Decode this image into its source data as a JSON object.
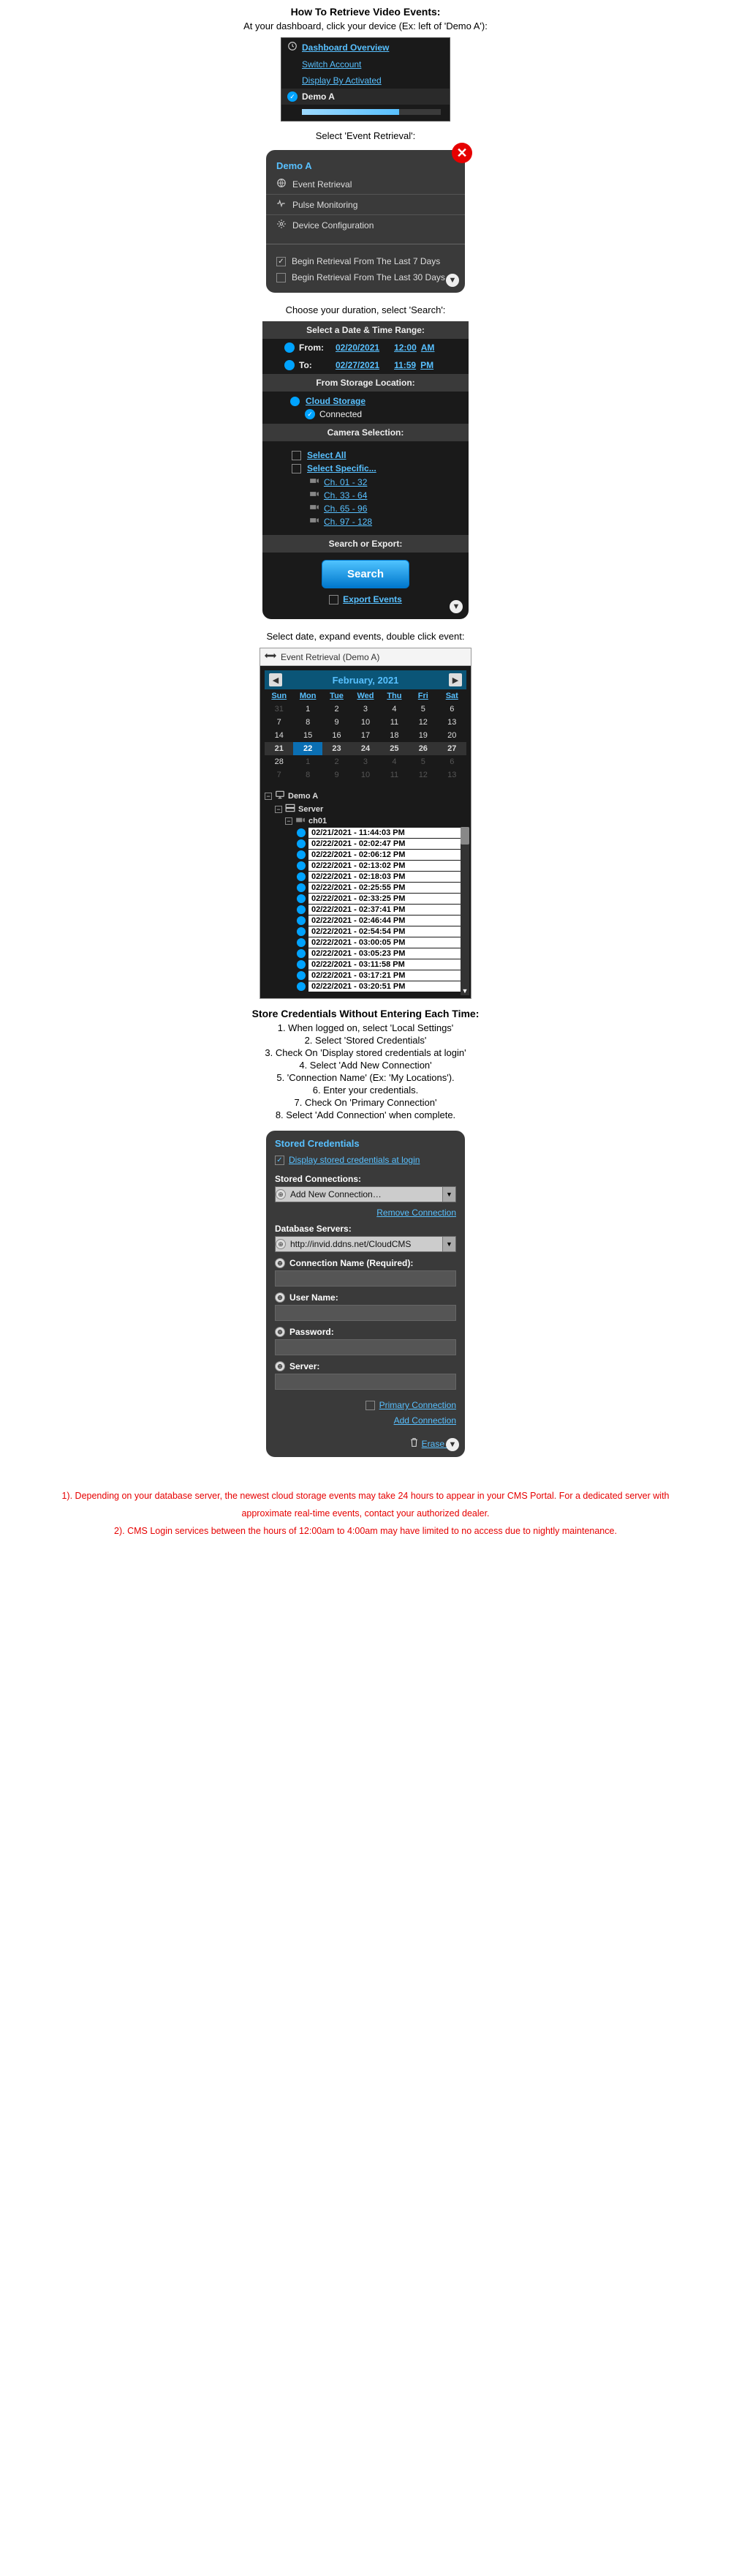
{
  "section1": {
    "title": "How To Retrieve Video Events:",
    "sub": "At your dashboard, click your device (Ex: left of 'Demo A'):"
  },
  "panel1": {
    "overview": "Dashboard Overview",
    "switch": "Switch Account",
    "display": "Display By Activated",
    "device": "Demo A"
  },
  "caption2": "Select 'Event Retrieval':",
  "panel2": {
    "header": "Demo A",
    "items": [
      {
        "label": "Event Retrieval"
      },
      {
        "label": "Pulse Monitoring"
      },
      {
        "label": "Device Configuration"
      }
    ],
    "opt7": "Begin Retrieval From The Last 7 Days",
    "opt30": "Begin Retrieval From The Last 30 Days"
  },
  "caption3": "Choose your duration, select 'Search':",
  "panel3": {
    "sec_date": "Select a Date & Time Range:",
    "from_label": "From:",
    "from_date": "02/20/2021",
    "from_time": "12:00",
    "from_ampm": "AM",
    "to_label": "To:",
    "to_date": "02/27/2021",
    "to_time": "11:59",
    "to_ampm": "PM",
    "sec_storage": "From Storage Location:",
    "cloud": "Cloud Storage",
    "connected": "Connected",
    "sec_cam": "Camera Selection:",
    "select_all": "Select All",
    "select_spec": "Select Specific...",
    "channels": [
      "Ch. 01 - 32",
      "Ch. 33 - 64",
      "Ch. 65 - 96",
      "Ch. 97 - 128"
    ],
    "sec_search": "Search or Export:",
    "search_btn": "Search",
    "export": "Export Events"
  },
  "caption4": "Select date, expand events, double click event:",
  "panel4": {
    "toolbar": "Event Retrieval (Demo A)",
    "month": "February, 2021",
    "dow": [
      "Sun",
      "Mon",
      "Tue",
      "Wed",
      "Thu",
      "Fri",
      "Sat"
    ],
    "grid": [
      [
        {
          "n": "31",
          "dim": true
        },
        {
          "n": "1"
        },
        {
          "n": "2"
        },
        {
          "n": "3"
        },
        {
          "n": "4"
        },
        {
          "n": "5"
        },
        {
          "n": "6"
        }
      ],
      [
        {
          "n": "7"
        },
        {
          "n": "8"
        },
        {
          "n": "9"
        },
        {
          "n": "10"
        },
        {
          "n": "11"
        },
        {
          "n": "12"
        },
        {
          "n": "13"
        }
      ],
      [
        {
          "n": "14"
        },
        {
          "n": "15"
        },
        {
          "n": "16"
        },
        {
          "n": "17"
        },
        {
          "n": "18"
        },
        {
          "n": "19"
        },
        {
          "n": "20"
        }
      ],
      [
        {
          "n": "21",
          "hl": true
        },
        {
          "n": "22",
          "sel": true
        },
        {
          "n": "23",
          "hl": true
        },
        {
          "n": "24",
          "hl": true
        },
        {
          "n": "25",
          "hl": true
        },
        {
          "n": "26",
          "hl": true
        },
        {
          "n": "27",
          "hl": true
        }
      ],
      [
        {
          "n": "28"
        },
        {
          "n": "1",
          "dim": true
        },
        {
          "n": "2",
          "dim": true
        },
        {
          "n": "3",
          "dim": true
        },
        {
          "n": "4",
          "dim": true
        },
        {
          "n": "5",
          "dim": true
        },
        {
          "n": "6",
          "dim": true
        }
      ],
      [
        {
          "n": "7",
          "dim": true
        },
        {
          "n": "8",
          "dim": true
        },
        {
          "n": "9",
          "dim": true
        },
        {
          "n": "10",
          "dim": true
        },
        {
          "n": "11",
          "dim": true
        },
        {
          "n": "12",
          "dim": true
        },
        {
          "n": "13",
          "dim": true
        }
      ]
    ],
    "root": "Demo A",
    "server": "Server",
    "channel": "ch01",
    "events": [
      "02/21/2021 - 11:44:03 PM",
      "02/22/2021 - 02:02:47 PM",
      "02/22/2021 - 02:06:12 PM",
      "02/22/2021 - 02:13:02 PM",
      "02/22/2021 - 02:18:03 PM",
      "02/22/2021 - 02:25:55 PM",
      "02/22/2021 - 02:33:25 PM",
      "02/22/2021 - 02:37:41 PM",
      "02/22/2021 - 02:46:44 PM",
      "02/22/2021 - 02:54:54 PM",
      "02/22/2021 - 03:00:05 PM",
      "02/22/2021 - 03:05:23 PM",
      "02/22/2021 - 03:11:58 PM",
      "02/22/2021 - 03:17:21 PM",
      "02/22/2021 - 03:20:51 PM"
    ]
  },
  "section5": {
    "title": "Store Credentials Without Entering Each Time:",
    "steps": [
      "1. When logged on, select 'Local Settings'",
      "2. Select 'Stored Credentials'",
      "3. Check On 'Display stored credentials at login'",
      "4. Select 'Add New Connection'",
      "5. 'Connection Name' (Ex: 'My Locations').",
      "6. Enter your credentials.",
      "7. Check On 'Primary Connection'",
      "8. Select 'Add Connection' when complete."
    ]
  },
  "panel5": {
    "title": "Stored Credentials",
    "display_chk": "Display stored credentials at login",
    "stored_label": "Stored Connections:",
    "stored_val": "Add New Connection…",
    "remove": "Remove Connection",
    "db_label": "Database Servers:",
    "db_val": "http://invid.ddns.net/CloudCMS",
    "conn_label": "Connection Name (Required):",
    "user_label": "User Name:",
    "pass_label": "Password:",
    "server_label": "Server:",
    "primary": "Primary Connection",
    "add": "Add Connection",
    "erase": "Erase All"
  },
  "footnotes": {
    "n1": "1). Depending on your database server, the newest cloud storage events may take 24 hours to appear in your CMS Portal. For a dedicated server with approximate real-time events, contact your authorized dealer.",
    "n2": "2). CMS Login services between the hours of 12:00am to 4:00am may have limited to no access due to nightly maintenance."
  }
}
